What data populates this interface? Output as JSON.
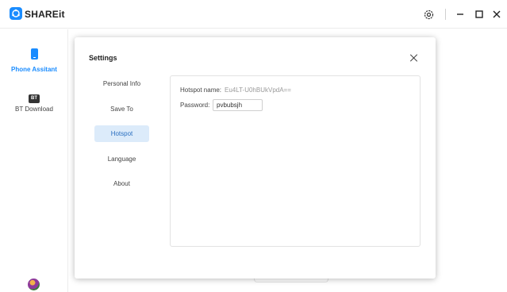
{
  "app": {
    "title": "SHAREit"
  },
  "window_controls": {
    "settings_icon": "gear-icon",
    "minimize_icon": "minimize-icon",
    "maximize_icon": "maximize-icon",
    "close_icon": "close-icon"
  },
  "sidebar": {
    "items": [
      {
        "label": "Phone Assitant",
        "icon": "phone-icon",
        "active": true
      },
      {
        "label": "BT Download",
        "icon": "bt-icon",
        "icon_text": "BT",
        "active": false
      }
    ],
    "accent_color": "#1a8cff"
  },
  "settings_dialog": {
    "title": "Settings",
    "menu": [
      {
        "label": "Personal Info",
        "active": false
      },
      {
        "label": "Save To",
        "active": false
      },
      {
        "label": "Hotspot",
        "active": true
      },
      {
        "label": "Language",
        "active": false
      },
      {
        "label": "About",
        "active": false
      }
    ],
    "hotspot": {
      "name_label": "Hotspot name:",
      "name_value": "Eu4LT-U0hBUkVpdA==",
      "password_label": "Password:",
      "password_value": "pvbubsjh"
    }
  }
}
